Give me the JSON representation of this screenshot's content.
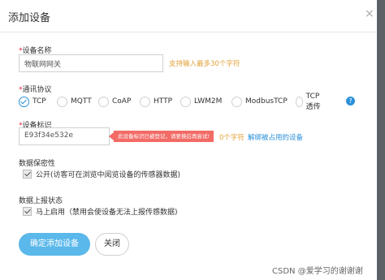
{
  "dialog": {
    "title": "添加设备",
    "close_icon": "close-icon"
  },
  "device_name": {
    "label": "设备名称",
    "required_mark": "*",
    "value": "物联网网关",
    "hint": "支持输入最多30个字符"
  },
  "protocol": {
    "label": "通讯协议",
    "required_mark": "*",
    "selected": "TCP",
    "options": [
      "TCP",
      "MQTT",
      "CoAP",
      "HTTP",
      "LWM2M",
      "ModbusTCP",
      "TCP透传"
    ],
    "help_icon": "question-icon",
    "help_text": "?"
  },
  "device_id": {
    "label": "设备标识",
    "required_mark": "*",
    "value": "E93f34e532e",
    "error_tip": "此设备标识已被登记，请更换后再尝试!",
    "hint_suffix": "0个字符",
    "unbind_link": "解绑被占用的设备"
  },
  "privacy": {
    "label": "数据保密性",
    "checkbox_label": "公开(访客可在浏览中阅览设备的传感器数据)",
    "checked": true
  },
  "report": {
    "label": "数据上报状态",
    "checkbox_label": "马上启用（禁用会使设备无法上报传感数据)",
    "checked": true
  },
  "buttons": {
    "confirm": "确定添加设备",
    "close": "关闭"
  },
  "watermark": "CSDN @爱学习的谢谢谢",
  "colors": {
    "primary": "#5bb8ea",
    "accent_blue": "#2a91d8",
    "hint_orange": "#e2a238",
    "error_red": "#f26b66"
  }
}
